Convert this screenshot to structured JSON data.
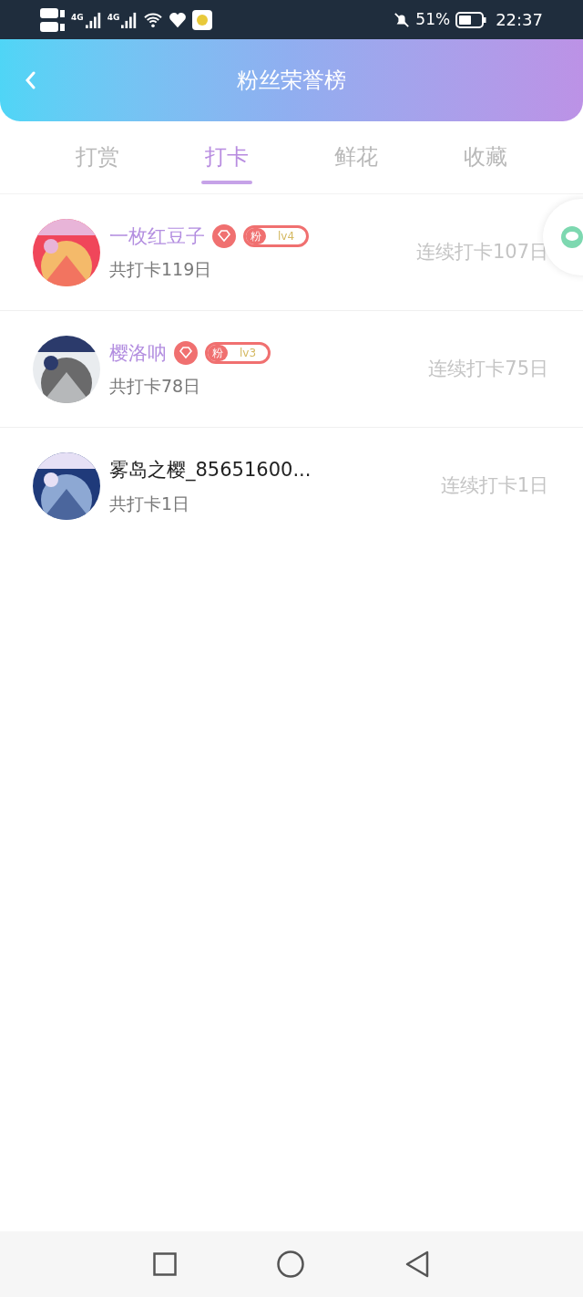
{
  "status_bar": {
    "battery": "51%",
    "time": "22:37",
    "signal_labels": [
      "4G",
      "4G"
    ]
  },
  "header": {
    "title": "粉丝荣誉榜"
  },
  "tabs": [
    {
      "label": "打赏",
      "selected": false
    },
    {
      "label": "打卡",
      "selected": true
    },
    {
      "label": "鲜花",
      "selected": false
    },
    {
      "label": "收藏",
      "selected": false
    }
  ],
  "fans": [
    {
      "name": "一枚红豆子",
      "fan": true,
      "badge": {
        "label": "粉",
        "level": "lv4"
      },
      "total": "共打卡119日",
      "streak": "连续打卡107日"
    },
    {
      "name": "樱洛呐",
      "fan": true,
      "badge": {
        "label": "粉",
        "level": "lv3"
      },
      "total": "共打卡78日",
      "streak": "连续打卡75日"
    },
    {
      "name": "雾岛之樱_85651600...",
      "fan": false,
      "total": "共打卡1日",
      "streak": "连续打卡1日"
    }
  ]
}
